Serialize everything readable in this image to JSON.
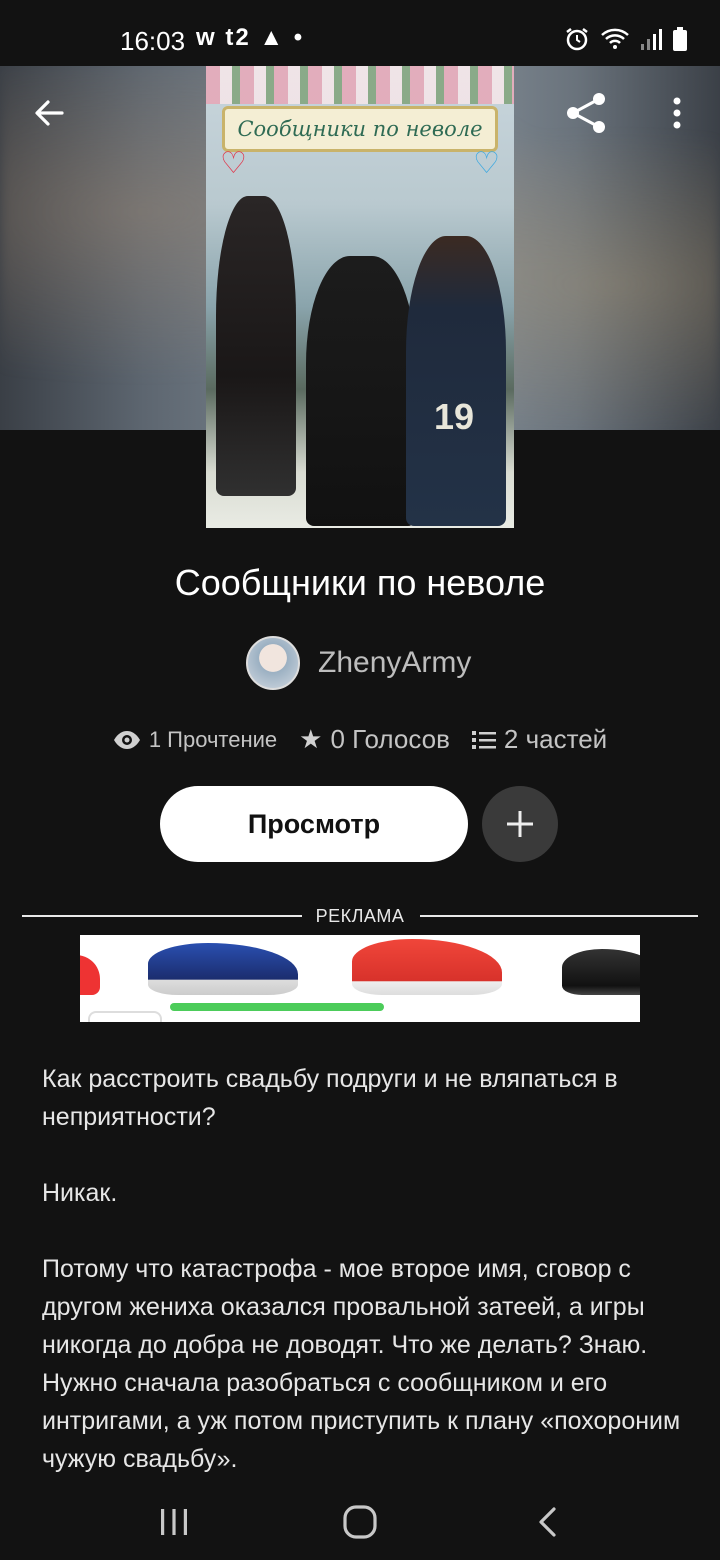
{
  "status_bar": {
    "time": "16:03",
    "left_icons_text": "w t2 ▲ •",
    "right_icons": [
      "alarm-icon",
      "wifi-icon",
      "signal-icon",
      "battery-icon"
    ]
  },
  "toolbar": {
    "back_icon": "arrow-left-icon",
    "share_icon": "share-icon",
    "more_icon": "more-vertical-icon"
  },
  "cover": {
    "banner_text": "Сообщники по неволе",
    "jersey_number": "19"
  },
  "book": {
    "title": "Сообщники по неволе",
    "author": "ZhenyArmy"
  },
  "stats": {
    "reads": "1 Прочтение",
    "votes": "0 Голосов",
    "parts": "2 частей"
  },
  "actions": {
    "read_label": "Просмотр",
    "add_label": "+"
  },
  "ad": {
    "label": "РЕКЛАМА"
  },
  "description": {
    "p1": "Как расстроить свадьбу подруги и не вляпаться в неприятности?",
    "p2": "Никак.",
    "p3": "Потому что катастрофа - мое второе имя, сговор с другом жениха оказался провальной затеей, а игры никогда до добра не доводят. Что же делать? Знаю. Нужно сначала разобраться с сообщником и его интригами, а уж потом приступить к плану «похороним чужую свадьбу»."
  },
  "nav_bar": {
    "recents_icon": "recents-icon",
    "home_icon": "home-icon",
    "back_icon": "nav-back-icon"
  }
}
